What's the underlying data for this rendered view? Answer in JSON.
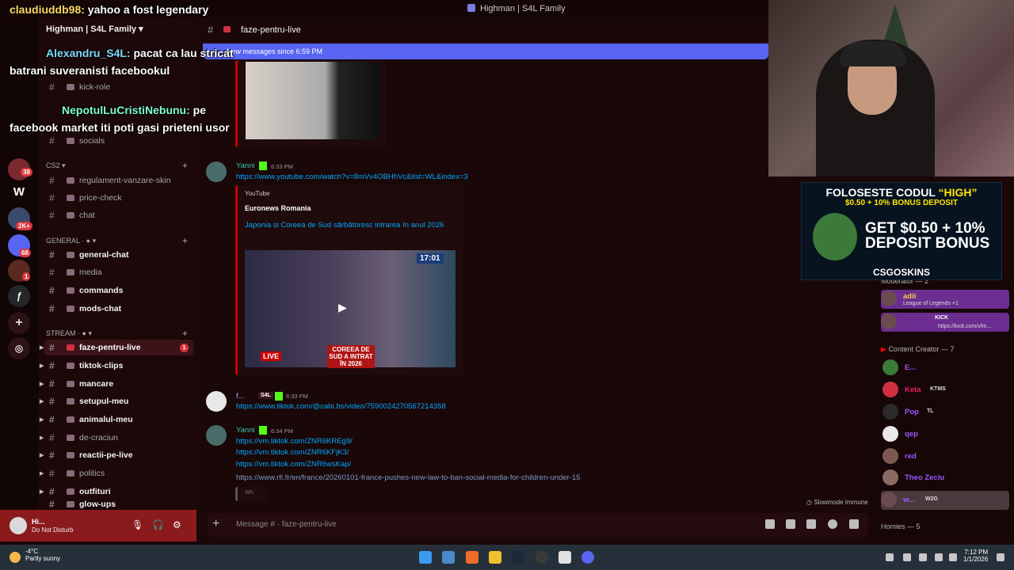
{
  "window": {
    "title": "Highman | S4L Family"
  },
  "server": {
    "name": "Highman | S4L Family"
  },
  "channel_header": {
    "name": "faze-pentru-live"
  },
  "new_messages_bar": {
    "text": "New messages since 6:59 PM"
  },
  "rail": {
    "badges": [
      "38",
      "2K+",
      "68",
      "1"
    ],
    "letter_server": "W"
  },
  "sidebar": {
    "top_channels": [
      "kick-role",
      "socials"
    ],
    "categories": [
      {
        "name": "CS2",
        "channels": [
          "regulament-vanzare-skin",
          "price-check",
          "chat"
        ]
      },
      {
        "name": "GENERAL",
        "channels": [
          "general-chat",
          "media",
          "commands",
          "mods-chat"
        ]
      },
      {
        "name": "STREAM",
        "channels": [
          "faze-pentru-live",
          "tiktok-clips",
          "mancare",
          "setupul-meu",
          "animalul-meu",
          "de-craciun",
          "reactii-pe-live",
          "politics",
          "outfituri",
          "glow-ups"
        ]
      }
    ],
    "selected_unread": "1"
  },
  "user_panel": {
    "name": "Hi...",
    "status": "Do Not Disturb"
  },
  "messages": [
    {
      "author": "Yanni",
      "time": "6:33 PM",
      "link": "https://www.youtube.com/watch?v=8mVv4OBHhVc&list=WL&index=3",
      "embed": {
        "provider": "YouTube",
        "site": "Euronews Romania",
        "title": "Japonia și Coreea de Sud sărbătoresc intrarea în anul 2026",
        "clock": "17:01",
        "caption": "COREEA DE SUD A INTRAT ÎN 2026",
        "live": "LIVE"
      }
    },
    {
      "author": "f...",
      "tag": "S4L",
      "time": "6:33 PM",
      "link": "https://www.tiktok.com/@cabi.bs/video/7590024270567214358"
    },
    {
      "author": "Yanni",
      "time": "6:34 PM",
      "links": [
        "https://vm.tiktok.com/ZNR6KREg9/",
        "https://vm.tiktok.com/ZNR6KFjK3/",
        "https://vm.tiktok.com/ZNR6wsKap/",
        "https://www.rfi.fr/en/france/20260101-france-pushes-new-law-to-ban-social-media-for-children-under-15"
      ],
      "embed_site": "RFI"
    }
  ],
  "chat_input": {
    "placeholder": "Message # · faze-pentru-live"
  },
  "slowmode": "Slowmode Immune",
  "members": {
    "moderator_header": "Moderator — 2",
    "moderators": [
      {
        "name": "adii",
        "sub": "League of Legends +1"
      },
      {
        "name": "KICK",
        "sub": "https://kick.com/vfm..."
      }
    ],
    "creator_header": "Content Creator — 7",
    "creators": [
      {
        "name": "E...",
        "color": "#9b59ff"
      },
      {
        "name": "Keta",
        "tag": "KTMS",
        "color": "#e91e63"
      },
      {
        "name": "Pop",
        "tag": "TL",
        "color": "#9b59ff"
      },
      {
        "name": "qep",
        "color": "#9b59ff"
      },
      {
        "name": "red",
        "color": "#9b59ff"
      },
      {
        "name": "Theo Zeciu",
        "color": "#9b59ff"
      },
      {
        "name": "w...",
        "tag": "W2G",
        "color": "#9b59ff"
      }
    ],
    "homies_header": "Homies — 5"
  },
  "overlay_chat": [
    {
      "user": "claudiuddb98:",
      "text": "yahoo a fost legendary"
    },
    {
      "user": "Alexandru_S4L:",
      "text": "pacat ca lau stricat batrani suveranisti facebookul"
    },
    {
      "user": "NepotulLuCristiNebunu:",
      "text": "pe facebook market iti poti gasi prieteni usor"
    }
  ],
  "ad": {
    "line1": "FOLOSESTE CODUL",
    "code": "“HIGH”",
    "line2": "$0.50 + 10% BONUS DEPOSIT",
    "headline1": "GET $0.50 + 10%",
    "headline2": "DEPOSIT BONUS",
    "brand": "CSGOSKINS"
  },
  "taskbar": {
    "temp": "-4°C",
    "weather": "Partly sunny",
    "time": "7:12 PM",
    "date": "1/1/2026"
  }
}
